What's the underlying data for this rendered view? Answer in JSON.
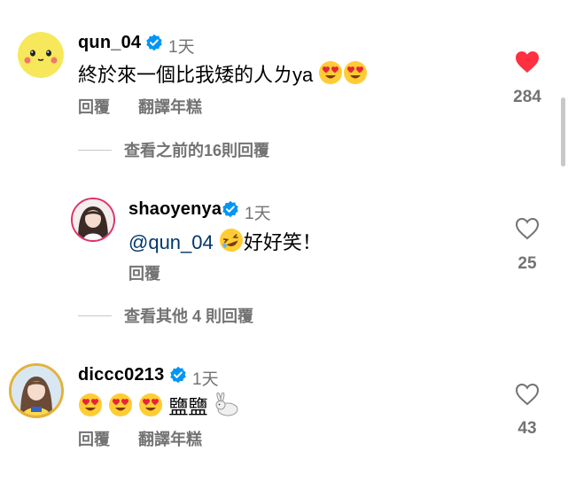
{
  "comments": [
    {
      "username": "qun_04",
      "time": "1天",
      "text_main": "終於來一個比我矮的人ㄌya",
      "emojis": [
        "heart-eyes-emoji",
        "heart-eyes-emoji"
      ],
      "reply_label": "回覆",
      "translate_label": "翻譯年糕",
      "likes": "284",
      "liked": true
    },
    {
      "username": "shaoyenya",
      "time": "1天",
      "mention": "@qun_04",
      "emoji": "rolling-laughing-emoji",
      "text_after": "好好笑！",
      "reply_label": "回覆",
      "likes": "25",
      "liked": false
    },
    {
      "username": "diccc0213",
      "time": "1天",
      "emojis": [
        "heart-eyes-emoji",
        "heart-eyes-emoji",
        "heart-eyes-emoji"
      ],
      "text_after": "鹽鹽",
      "trailing_emoji": "rabbit-emoji",
      "reply_label": "回覆",
      "translate_label": "翻譯年糕",
      "likes": "43",
      "liked": false
    }
  ],
  "view_previous_replies": "查看之前的16則回覆",
  "view_other_replies": "查看其他 4 則回覆",
  "colors": {
    "liked_heart": "#ff3040",
    "secondary_text": "#737373",
    "verified_badge": "#0095f6",
    "mention": "#00376b"
  }
}
